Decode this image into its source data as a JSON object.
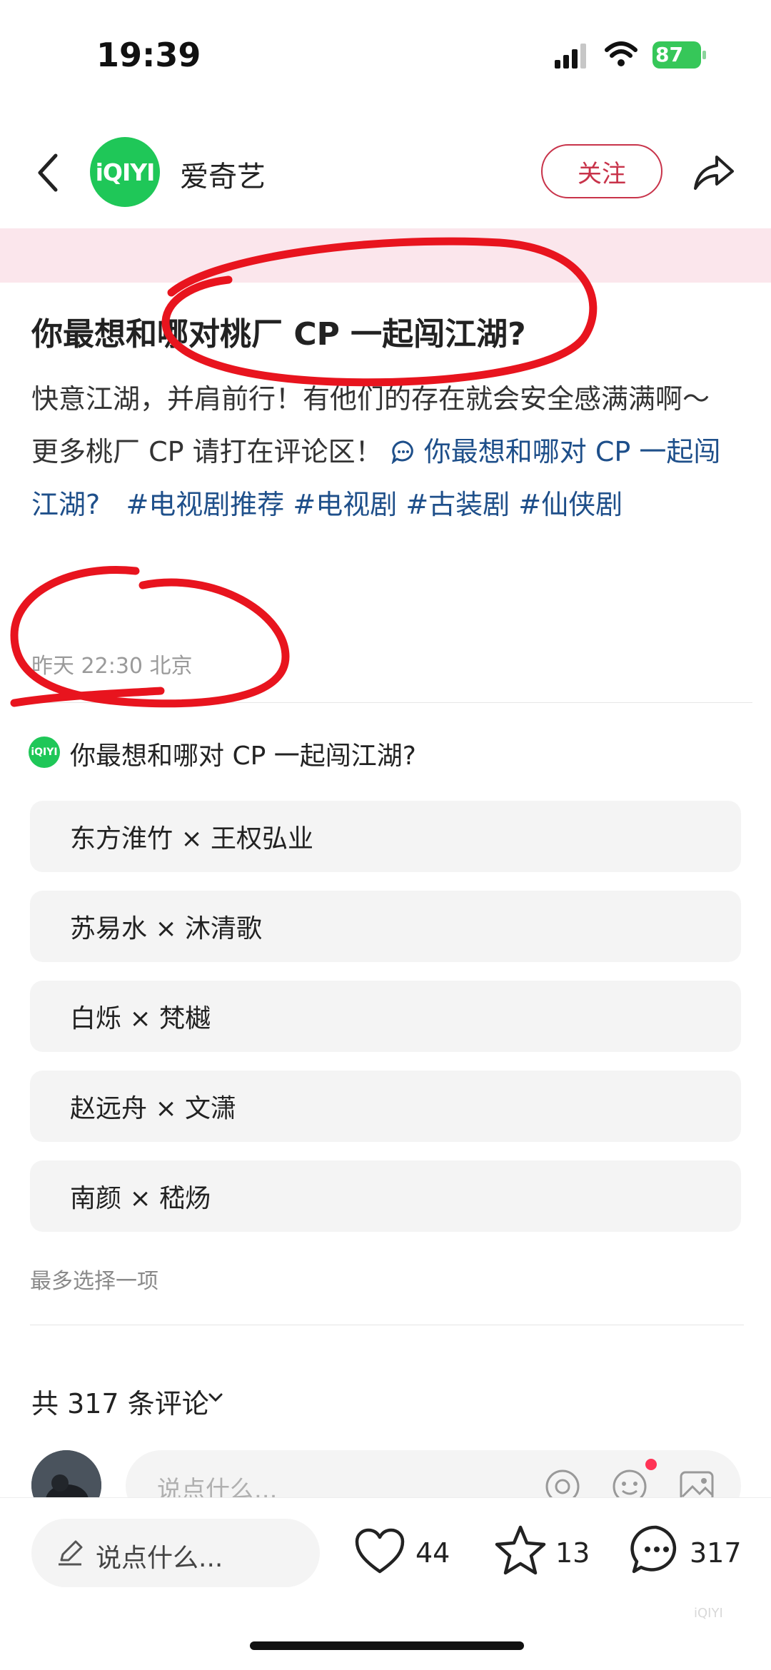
{
  "status_bar": {
    "time": "19:39",
    "battery": "87"
  },
  "header": {
    "account_name": "爱奇艺",
    "avatar_text": "iQIYI",
    "follow_label": "关注"
  },
  "post": {
    "title": "你最想和哪对桃厂 CP 一起闯江湖?",
    "body_line1": "快意江湖，并肩前行！有他们的存在就会安全感满满啊～",
    "body_line2_prefix": "更多桃厂 CP 请打在评论区！",
    "topic_link": "你最想和哪对 CP 一起闯江湖?",
    "hashtags": [
      "#电视剧推荐",
      "#电视剧",
      "#古装剧",
      "#仙侠剧"
    ],
    "meta": "昨天 22:30 北京"
  },
  "vote": {
    "logo_text": "iQIYI",
    "title": "你最想和哪对 CP 一起闯江湖?",
    "options": [
      "东方淮竹 × 王权弘业",
      "苏易水 × 沐清歌",
      "白烁 × 梵樾",
      "赵远舟 × 文潇",
      "南颜 × 嵇炀"
    ],
    "hint": "最多选择一项"
  },
  "comments": {
    "count_label": "共 317 条评论",
    "placeholder": "说点什么..."
  },
  "bottom_bar": {
    "say_placeholder": "说点什么...",
    "likes": "44",
    "stars": "13",
    "comments": "317"
  },
  "watermark": "iQIYI",
  "colors": {
    "accent_red": "#c8334a",
    "brand_green": "#1fc758",
    "link_blue": "#1e4f8a",
    "annotation_red": "#e8141e"
  }
}
